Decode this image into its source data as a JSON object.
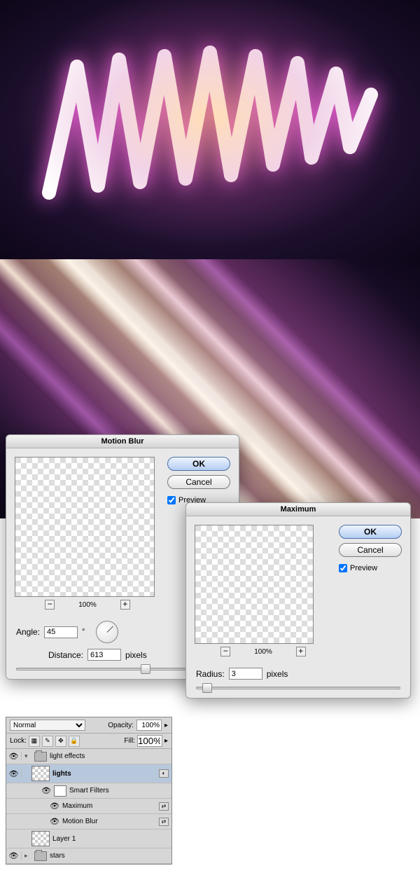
{
  "dialogs": {
    "motion_blur": {
      "title": "Motion Blur",
      "ok": "OK",
      "cancel": "Cancel",
      "preview_label": "Preview",
      "preview_checked": true,
      "zoom": "100%",
      "angle_label": "Angle:",
      "angle_value": "45",
      "angle_unit": "°",
      "distance_label": "Distance:",
      "distance_value": "613",
      "distance_unit": "pixels"
    },
    "maximum": {
      "title": "Maximum",
      "ok": "OK",
      "cancel": "Cancel",
      "preview_label": "Preview",
      "preview_checked": true,
      "zoom": "100%",
      "radius_label": "Radius:",
      "radius_value": "3",
      "radius_unit": "pixels"
    }
  },
  "layers": {
    "blend_mode": "Normal",
    "opacity_label": "Opacity:",
    "opacity_value": "100%",
    "lock_label": "Lock:",
    "fill_label": "Fill:",
    "fill_value": "100%",
    "items": {
      "group_light_effects": "light effects",
      "lights": "lights",
      "smart_filters": "Smart Filters",
      "maximum": "Maximum",
      "motion_blur": "Motion Blur",
      "layer1": "Layer 1",
      "group_stars": "stars"
    }
  },
  "glyphs": {
    "minus": "−",
    "plus": "+",
    "eye": "👁",
    "tri_down": "▾",
    "tri_right": "▸",
    "arrow": "▸"
  }
}
